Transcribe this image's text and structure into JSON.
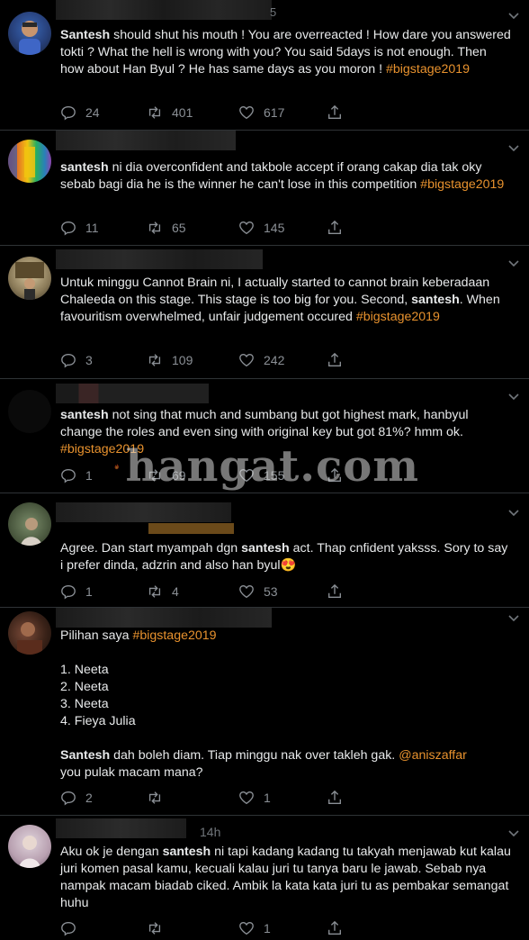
{
  "tweets": [
    {
      "header_partial": "5",
      "text_parts": [
        {
          "type": "bold",
          "text": "Santesh"
        },
        {
          "type": "text",
          "text": " should shut his mouth ! You are overreacted ! How dare you answered tokti ? What the hell is wrong with you? You said 5days is not enough. Then how about Han Byul ? He has same days as you moron ! "
        },
        {
          "type": "hashtag",
          "text": "#bigstage2019"
        }
      ],
      "replies": "24",
      "retweets": "401",
      "likes": "617"
    },
    {
      "text_parts": [
        {
          "type": "bold",
          "text": "santesh"
        },
        {
          "type": "text",
          "text": " ni dia overconfident and takbole accept if orang cakap dia tak oky sebab bagi dia he is the winner he can't lose in this competition "
        },
        {
          "type": "hashtag",
          "text": "#bigstage2019"
        }
      ],
      "replies": "11",
      "retweets": "65",
      "likes": "145"
    },
    {
      "text_parts": [
        {
          "type": "text",
          "text": "Untuk minggu Cannot Brain ni, I actually started to cannot brain keberadaan Chaleeda on this stage. This stage is too big for you. Second, "
        },
        {
          "type": "bold",
          "text": "santesh"
        },
        {
          "type": "text",
          "text": ". When favouritism overwhelmed, unfair judgement occured "
        },
        {
          "type": "hashtag",
          "text": "#bigstage2019"
        }
      ],
      "replies": "3",
      "retweets": "109",
      "likes": "242"
    },
    {
      "text_parts": [
        {
          "type": "bold",
          "text": "santesh"
        },
        {
          "type": "text",
          "text": " not sing that much and sumbang but got highest mark, hanbyul change the roles and even sing with original key but got 81%? hmm ok. "
        },
        {
          "type": "hashtag",
          "text": "#bigstage2019"
        }
      ],
      "replies": "1",
      "retweets": "69",
      "likes": "155"
    },
    {
      "text_parts": [
        {
          "type": "text",
          "text": "Agree. Dan start myampah dgn "
        },
        {
          "type": "bold",
          "text": "santesh"
        },
        {
          "type": "text",
          "text": " act. Thap cnfident yaksss. Sory to say i prefer dinda, adzrin and also han byul"
        },
        {
          "type": "emoji",
          "text": "😍"
        }
      ],
      "replies": "1",
      "retweets": "4",
      "likes": "53"
    },
    {
      "text_parts": [
        {
          "type": "text",
          "text": "Pilihan saya "
        },
        {
          "type": "hashtag",
          "text": "#bigstage2019"
        },
        {
          "type": "text",
          "text": "\n\n1. Neeta\n2. Neeta\n3. Neeta\n4. Fieya Julia\n\n"
        },
        {
          "type": "bold",
          "text": "Santesh"
        },
        {
          "type": "text",
          "text": " dah boleh diam. Tiap minggu nak over takleh gak. "
        },
        {
          "type": "mention",
          "text": "@aniszaffar"
        },
        {
          "type": "text",
          "text": "\nyou pulak macam mana?"
        }
      ],
      "replies": "2",
      "retweets": "",
      "likes": "1"
    },
    {
      "time": "14h",
      "text_parts": [
        {
          "type": "text",
          "text": "Aku ok je dengan "
        },
        {
          "type": "bold",
          "text": "santesh"
        },
        {
          "type": "text",
          "text": " ni tapi kadang kadang tu takyah menjawab kut kalau juri komen pasal kamu, kecuali kalau juri tu tanya baru le jawab. Sebab nya nampak macam biadab ciked. Ambik la kata kata juri tu as pembakar semangat huhu"
        }
      ],
      "replies": "",
      "retweets": "",
      "likes": "1"
    }
  ],
  "watermark": {
    "text": "hangat.com"
  },
  "colors": {
    "background": "#000000",
    "text": "#e7e9ea",
    "hashtag": "#e8922e",
    "muted": "#8b9096",
    "divider": "#2f3336"
  }
}
